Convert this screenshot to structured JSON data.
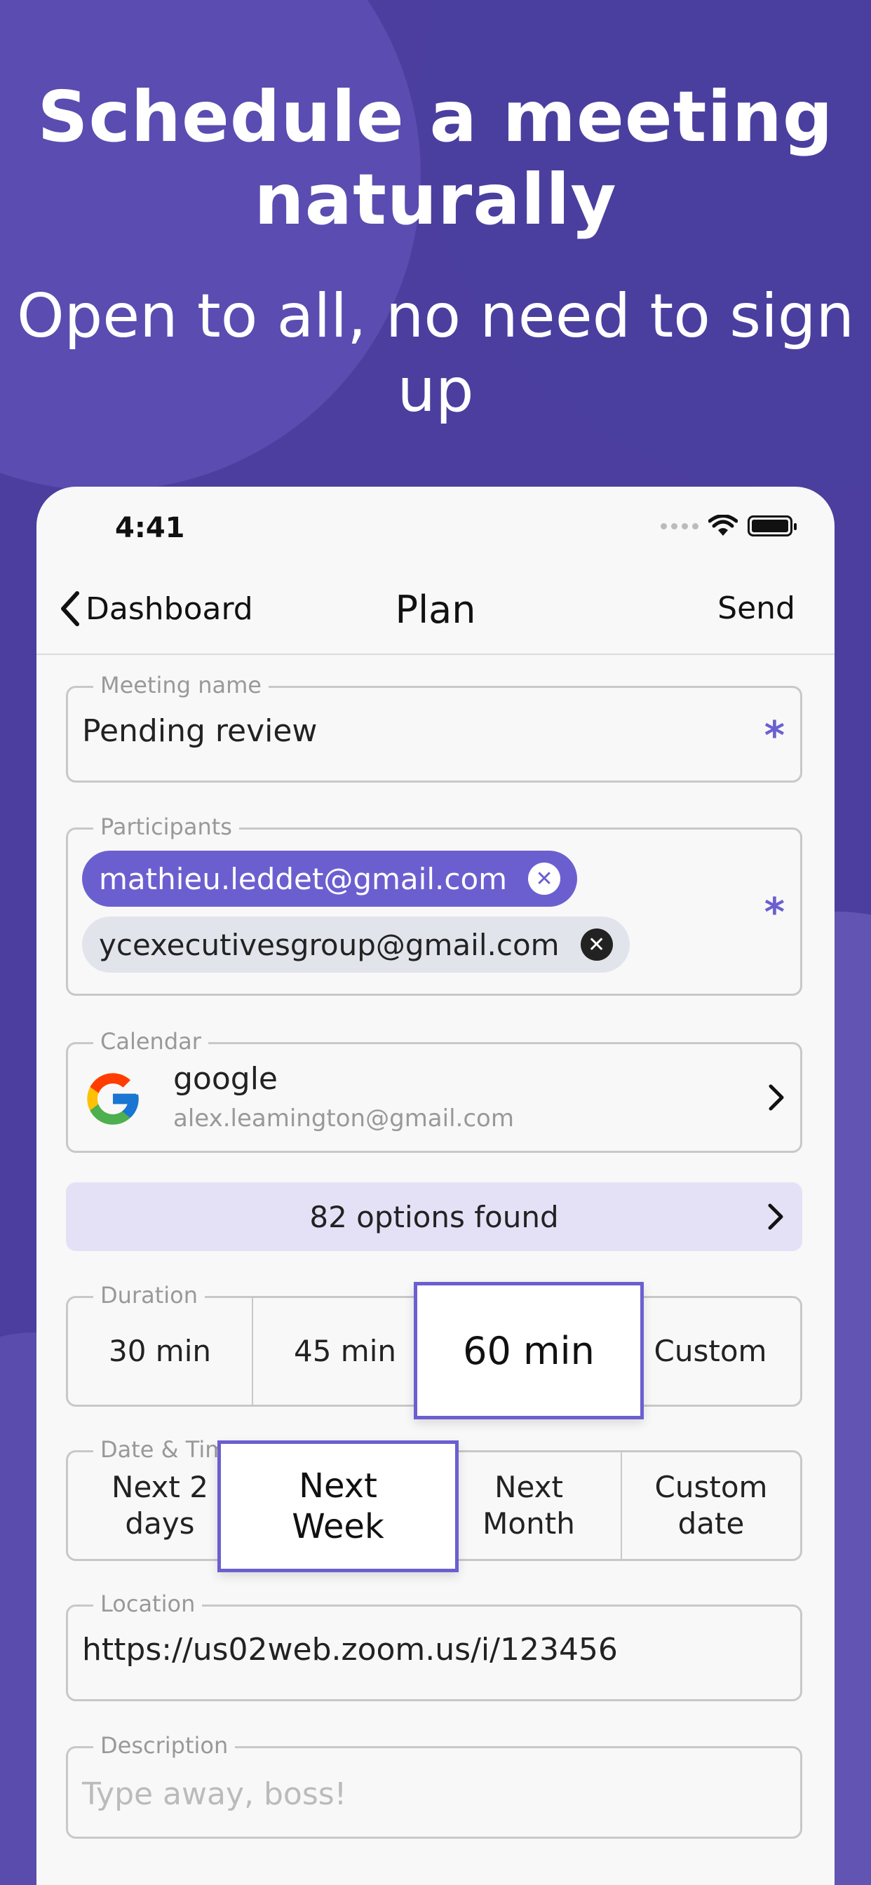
{
  "headline": "Schedule a meeting naturally",
  "subline": "Open to all, no need to sign up",
  "status": {
    "time": "4:41"
  },
  "nav": {
    "back_label": "Dashboard",
    "title": "Plan",
    "send_label": "Send"
  },
  "meeting_name": {
    "legend": "Meeting name",
    "value": "Pending review",
    "required": "*"
  },
  "participants": {
    "legend": "Participants",
    "required": "*",
    "items": [
      {
        "email": "mathieu.leddet@gmail.com"
      },
      {
        "email": "ycexecutivesgroup@gmail.com"
      }
    ]
  },
  "calendar": {
    "legend": "Calendar",
    "provider": "google",
    "account": "alex.leamington@gmail.com"
  },
  "options_found": "82 options found",
  "duration": {
    "legend": "Duration",
    "options": [
      "30 min",
      "45 min",
      "60 min",
      "Custom"
    ],
    "selected": "60 min"
  },
  "date_time": {
    "legend": "Date & Tim",
    "options": [
      "Next 2 days",
      "Next Week",
      "Next Month",
      "Custom date"
    ],
    "selected": "Next Week"
  },
  "location": {
    "legend": "Location",
    "value": "https://us02web.zoom.us/i/123456"
  },
  "description": {
    "legend": "Description",
    "placeholder": "Type away, boss!"
  },
  "colors": {
    "accent": "#6b5fd0",
    "background": "#4b3e9e",
    "options_bg": "#e4e1f7"
  }
}
